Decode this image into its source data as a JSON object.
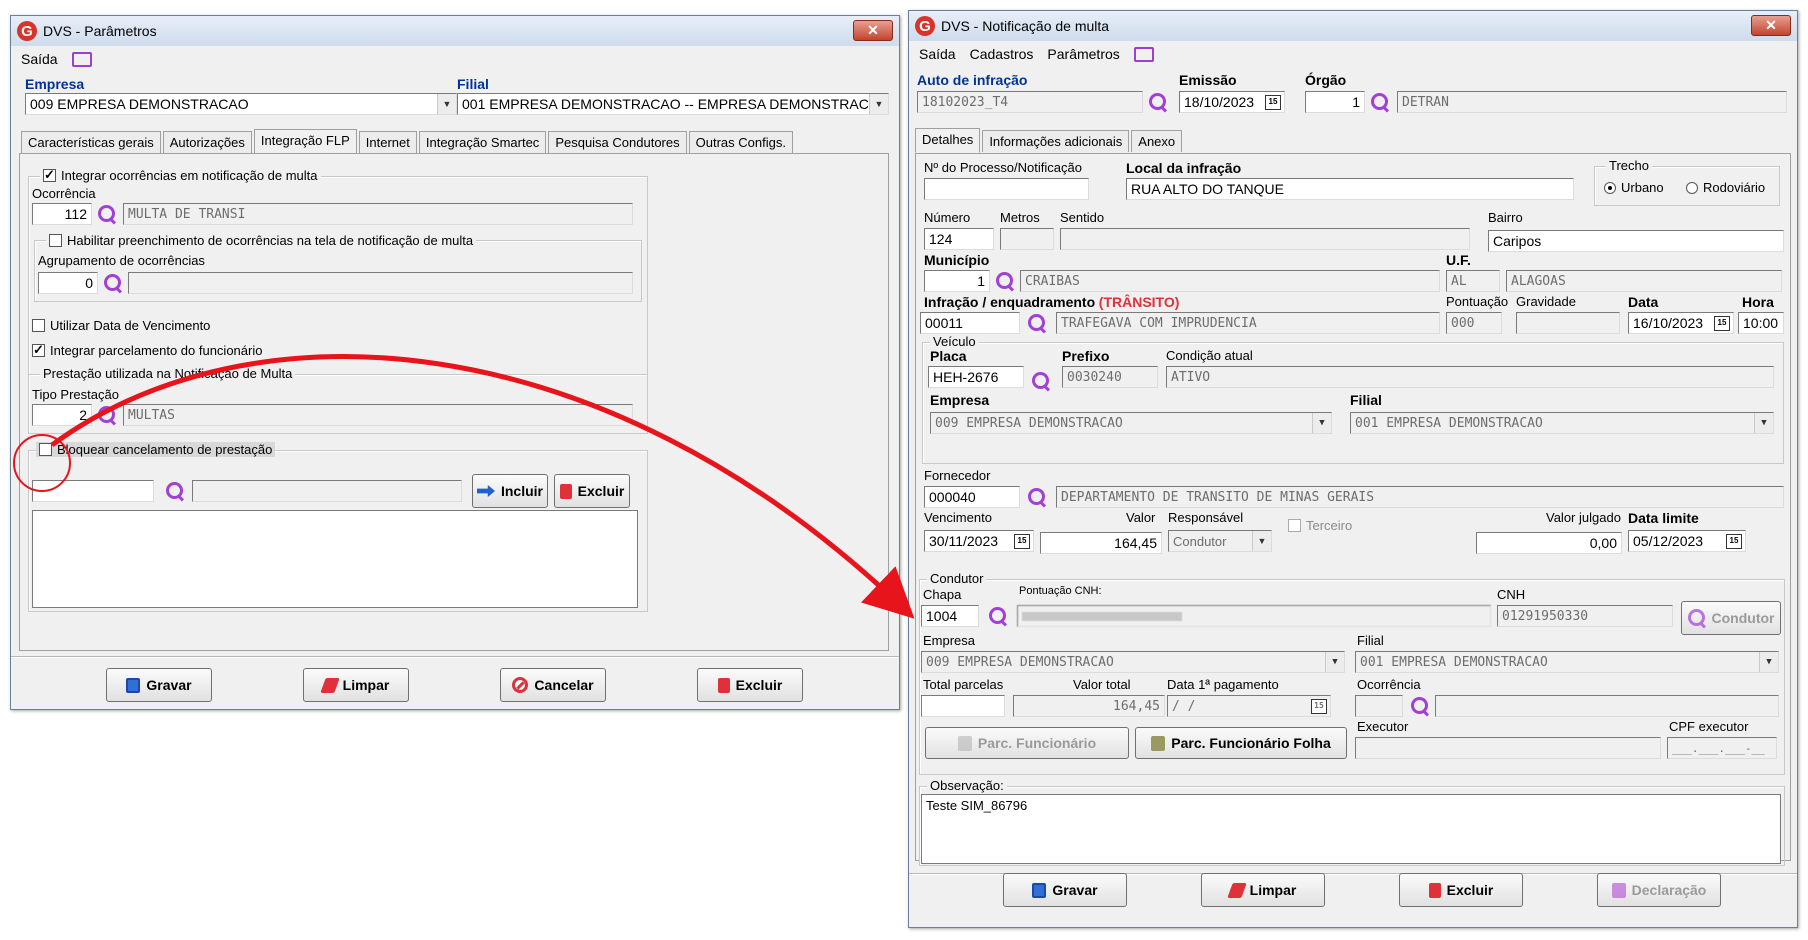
{
  "win1": {
    "title": "DVS - Parâmetros",
    "close": "✕",
    "menu": {
      "saida": "Saída"
    },
    "empresa_label": "Empresa",
    "empresa_value": "009 EMPRESA DEMONSTRACAO",
    "filial_label": "Filial",
    "filial_value": "001 EMPRESA DEMONSTRACAO -- EMPRESA DEMONSTRACA",
    "tabs": [
      "Características gerais",
      "Autorizações",
      "Integração FLP",
      "Internet",
      "Integração Smartec",
      "Pesquisa Condutores",
      "Outras Configs."
    ],
    "integrar_ocorrencias": "Integrar ocorrências em notificação de multa",
    "ocorrencia_label": "Ocorrência",
    "ocorrencia_code": "112",
    "ocorrencia_desc": "MULTA DE TRANSI",
    "habilitar": "Habilitar preenchimento de ocorrências na tela de notificação de multa",
    "agrupamento_label": "Agrupamento de ocorrências",
    "agrupamento_code": "0",
    "utilizar_data": "Utilizar Data de Vencimento",
    "integrar_parcelamento": "Integrar parcelamento do funcionário",
    "prestacao_group": "Prestação utilizada na Notificação de Multa",
    "tipo_prestacao_label": "Tipo Prestação",
    "tipo_prestacao_code": "2",
    "tipo_prestacao_desc": "MULTAS",
    "bloquear": "Bloquear cancelamento de prestação",
    "incluir": "Incluir",
    "excluir_small": "Excluir",
    "gravar": "Gravar",
    "limpar": "Limpar",
    "cancelar": "Cancelar",
    "excluir": "Excluir"
  },
  "win2": {
    "title": "DVS - Notificação de multa",
    "close": "✕",
    "menu": {
      "saida": "Saída",
      "cadastros": "Cadastros",
      "parametros": "Parâmetros"
    },
    "auto_label": "Auto de infração",
    "auto_value": "18102023_T4",
    "emissao_label": "Emissão",
    "emissao_value": "18/10/2023",
    "orgao_label": "Órgão",
    "orgao_code": "1",
    "orgao_desc": "DETRAN",
    "tabs": [
      "Detalhes",
      "Informações adicionais",
      "Anexo"
    ],
    "processo_label": "Nº do Processo/Notificação",
    "local_label": "Local da infração",
    "local_value": "RUA ALTO DO TANQUE",
    "trecho_label": "Trecho",
    "urbano": "Urbano",
    "rodoviario": "Rodoviário",
    "numero_label": "Número",
    "numero_value": "124",
    "metros_label": "Metros",
    "sentido_label": "Sentido",
    "bairro_label": "Bairro",
    "bairro_value": "Caripos",
    "municipio_label": "Município",
    "municipio_code": "1",
    "municipio_desc": "CRAIBAS",
    "uf_label": "U.F.",
    "uf_value": "AL",
    "uf_desc": "ALAGOAS",
    "infracao_label": "Infração / enquadramento",
    "transito": "(TRÂNSITO)",
    "infracao_code": "00011",
    "infracao_desc": "TRAFEGAVA COM IMPRUDENCIA",
    "pontuacao_label": "Pontuação",
    "pontuacao_value": "000",
    "gravidade_label": "Gravidade",
    "data_label": "Data",
    "data_value": "16/10/2023",
    "hora_label": "Hora",
    "hora_value": "10:00",
    "veiculo_group": "Veículo",
    "placa_label": "Placa",
    "placa_value": "HEH-2676",
    "prefixo_label": "Prefixo",
    "prefixo_value": "0030240",
    "condicao_label": "Condição atual",
    "condicao_value": "ATIVO",
    "empresa_label": "Empresa",
    "empresa_value": "009 EMPRESA DEMONSTRACAO",
    "filial_label": "Filial",
    "filial_value": "001 EMPRESA DEMONSTRACAO",
    "fornecedor_label": "Fornecedor",
    "fornecedor_code": "000040",
    "fornecedor_desc": "DEPARTAMENTO DE TRANSITO DE MINAS GERAIS",
    "vencimento_label": "Vencimento",
    "vencimento_value": "30/11/2023",
    "valor_label": "Valor",
    "valor_value": "164,45",
    "responsavel_label": "Responsável",
    "responsavel_value": "Condutor",
    "terceiro": "Terceiro",
    "valor_julgado_label": "Valor julgado",
    "valor_julgado_value": "0,00",
    "data_limite_label": "Data limite",
    "data_limite_value": "05/12/2023",
    "condutor_group": "Condutor",
    "chapa_label": "Chapa",
    "chapa_value": "1004",
    "pontuacao_cnh_label": "Pontuação CNH:",
    "cnh_label": "CNH",
    "cnh_value": "01291950330",
    "condutor_btn": "Condutor",
    "c_empresa_label": "Empresa",
    "c_empresa_value": "009 EMPRESA DEMONSTRACAO",
    "c_filial_label": "Filial",
    "c_filial_value": "001 EMPRESA DEMONSTRACAO",
    "total_parcelas_label": "Total parcelas",
    "valor_total_label": "Valor total",
    "valor_total_value": "164,45",
    "data_pagamento_label": "Data 1ª pagamento",
    "data_pagamento_value": " / /",
    "ocorrencia_label": "Ocorrência",
    "parc_func": "Parc. Funcionário",
    "parc_func_folha": "Parc. Funcionário Folha",
    "executor_label": "Executor",
    "cpf_executor_label": "CPF executor",
    "cpf_executor_value": "___.___.___-__",
    "observacao_label": "Observação:",
    "observacao_value": "Teste SIM_86796",
    "gravar": "Gravar",
    "limpar": "Limpar",
    "excluir": "Excluir",
    "declaracao": "Declaração"
  },
  "colors": {
    "accent_blue": "#003399",
    "danger_red": "#e0303a",
    "search_purple": "#a13fd6"
  }
}
